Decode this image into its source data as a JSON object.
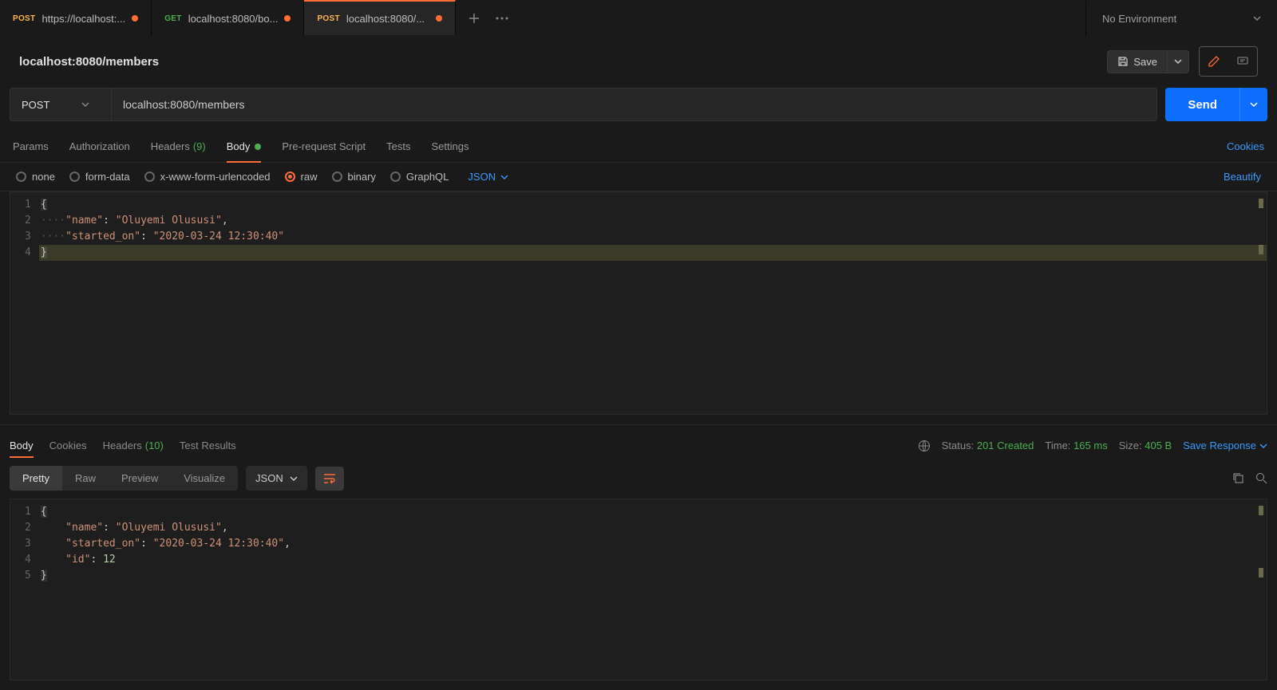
{
  "tabs": [
    {
      "method": "POST",
      "method_class": "method-post",
      "title": "https://localhost:...",
      "active": false
    },
    {
      "method": "GET",
      "method_class": "method-get",
      "title": "localhost:8080/bo...",
      "active": false
    },
    {
      "method": "POST",
      "method_class": "method-post",
      "title": "localhost:8080/...",
      "active": true
    }
  ],
  "environment": {
    "label": "No Environment"
  },
  "request_title": "localhost:8080/members",
  "save_label": "Save",
  "method": "POST",
  "url": "localhost:8080/members",
  "send_label": "Send",
  "req_tabs": {
    "params": "Params",
    "authorization": "Authorization",
    "headers": "Headers",
    "headers_count": "(9)",
    "body": "Body",
    "prerequest": "Pre-request Script",
    "tests": "Tests",
    "settings": "Settings",
    "cookies": "Cookies"
  },
  "body_types": {
    "none": "none",
    "form_data": "form-data",
    "urlencoded": "x-www-form-urlencoded",
    "raw": "raw",
    "binary": "binary",
    "graphql": "GraphQL",
    "raw_type": "JSON",
    "beautify": "Beautify"
  },
  "request_body": {
    "line1": "{",
    "line2_key": "\"name\"",
    "line2_val": "\"Oluyemi Olususi\"",
    "line3_key": "\"started_on\"",
    "line3_val": "\"2020-03-24 12:30:40\"",
    "line4": "}"
  },
  "response": {
    "tabs": {
      "body": "Body",
      "cookies": "Cookies",
      "headers": "Headers",
      "headers_count": "(10)",
      "test_results": "Test Results"
    },
    "status_label": "Status:",
    "status_value": "201 Created",
    "time_label": "Time:",
    "time_value": "165 ms",
    "size_label": "Size:",
    "size_value": "405 B",
    "save_response": "Save Response",
    "views": {
      "pretty": "Pretty",
      "raw": "Raw",
      "preview": "Preview",
      "visualize": "Visualize",
      "format": "JSON"
    },
    "body": {
      "line1": "{",
      "line2_key": "\"name\"",
      "line2_val": "\"Oluyemi Olususi\"",
      "line3_key": "\"started_on\"",
      "line3_val": "\"2020-03-24 12:30:40\"",
      "line4_key": "\"id\"",
      "line4_val": "12",
      "line5": "}"
    }
  }
}
